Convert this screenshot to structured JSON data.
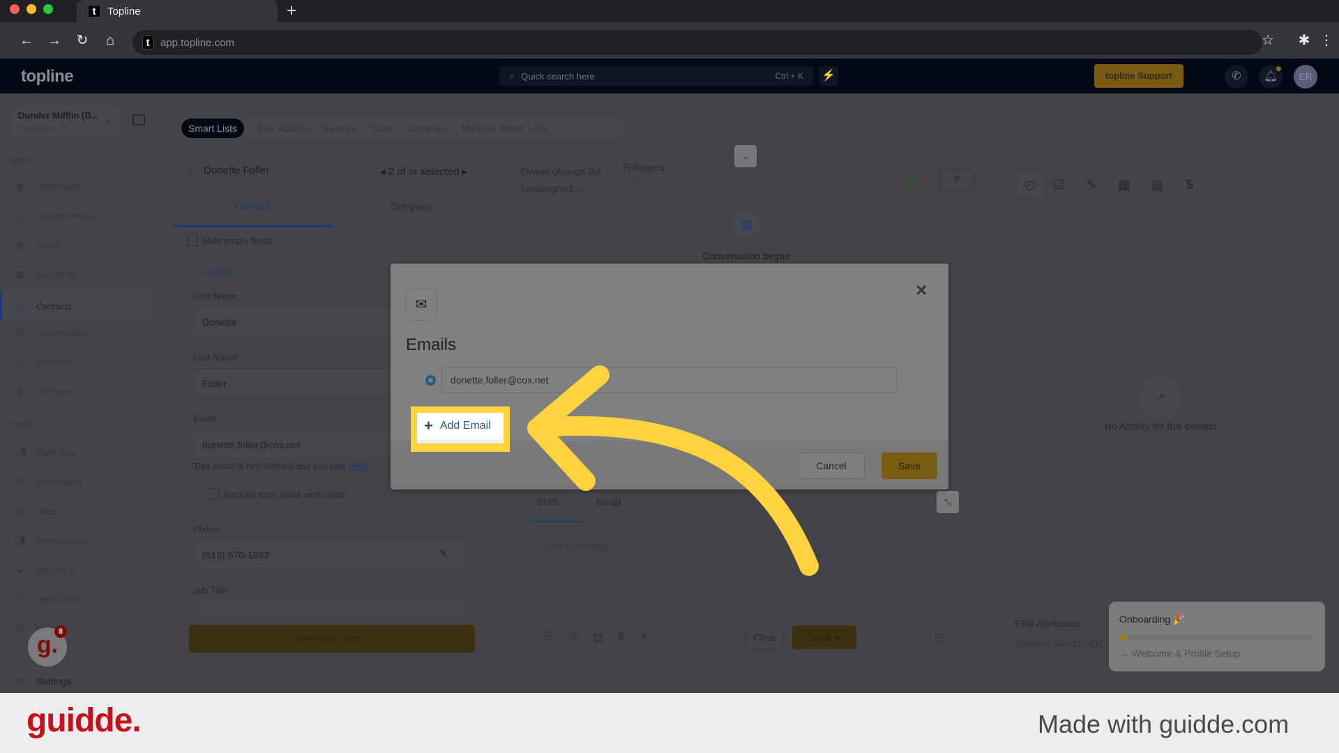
{
  "browser": {
    "tab_title": "Topline",
    "url": "app.topline.com",
    "favicon_letter": "t"
  },
  "header": {
    "logo": "topline",
    "search_placeholder": "Quick search here",
    "search_shortcut": "Ctrl + K",
    "support_label": "topline Support",
    "avatar_initials": "ER"
  },
  "sidebar": {
    "account_name": "Dunder Mifflin [D...",
    "account_location": "Scranton, PA",
    "apps_label": "Apps",
    "tools_label": "Tools",
    "apps": [
      {
        "label": "Dashboard",
        "icon": "dashboard-icon"
      },
      {
        "label": "Conversations",
        "icon": "chat-icon"
      },
      {
        "label": "Tasks",
        "icon": "task-icon"
      },
      {
        "label": "Scheduler",
        "icon": "calendar-icon"
      },
      {
        "label": "Contacts",
        "icon": "person-icon",
        "active": true
      },
      {
        "label": "Opportunities",
        "icon": "target-icon"
      },
      {
        "label": "Revenue",
        "icon": "card-icon"
      },
      {
        "label": "Contracts",
        "icon": "document-icon"
      }
    ],
    "tools": [
      {
        "label": "Marketing",
        "icon": "megaphone-icon"
      },
      {
        "label": "Automation",
        "icon": "gears-icon"
      },
      {
        "label": "Sites",
        "icon": "globe-icon"
      },
      {
        "label": "Memberships",
        "icon": "users-icon"
      },
      {
        "label": "Reporting",
        "icon": "pie-icon"
      },
      {
        "label": "Help Desk",
        "icon": "help-icon"
      },
      {
        "label": "Mailbox",
        "icon": "mail-icon"
      }
    ],
    "settings_label": "Settings"
  },
  "top_tabs": [
    "Smart Lists",
    "Bulk Actions",
    "Restore",
    "Tasks",
    "Company",
    "Manage Smart Lists"
  ],
  "contact": {
    "name": "Donette Foller",
    "pager_prefix": "2 of",
    "pager_total": "76",
    "pager_suffix": "selected",
    "tabs": [
      "Contact",
      "Company"
    ],
    "hide_empty": "Hide empty fields",
    "section": "Contact",
    "first_name_label": "First Name",
    "first_name": "Donette",
    "last_name_label": "Last Name",
    "last_name": "Foller",
    "email_label": "Email",
    "email": "donette.foller@cox.net",
    "verify_text": "This email is Not Verified and you can",
    "verify_link": "Verify",
    "exclude_label": "Exclude from email verification",
    "phone_label": "Phone",
    "phone": "(513) 570-1893",
    "job_title_label": "Job Title",
    "audit_label": "View Audit Logs"
  },
  "conversation": {
    "owner_label": "Owner (Assign To)",
    "owner_value": "Unassigned",
    "followers_label": "Followers",
    "began": "Conversation began",
    "tabs": [
      "SMS",
      "Email"
    ],
    "placeholder": "Type a message",
    "clear_label": "Clear",
    "send_label": "Send"
  },
  "activity": {
    "empty": "No Activity for this contact",
    "first_attribution": "First Attribution",
    "session_source": "Session Source: CR"
  },
  "onboarding": {
    "title": "Onboarding 🎉",
    "progress_percent": 3,
    "step": "Welcome & Profile Setup"
  },
  "guidde_badge": {
    "count": "8"
  },
  "modal": {
    "title": "Emails",
    "email_value": "donette.foller@cox.net",
    "add_label": "Add Email",
    "cancel_label": "Cancel",
    "save_label": "Save"
  },
  "footer": {
    "logo": "guidde.",
    "tagline": "Made with guidde.com"
  },
  "colors": {
    "highlight": "#ffd23f",
    "accent_gold": "#b8860b",
    "brand_red": "#c8101a"
  }
}
